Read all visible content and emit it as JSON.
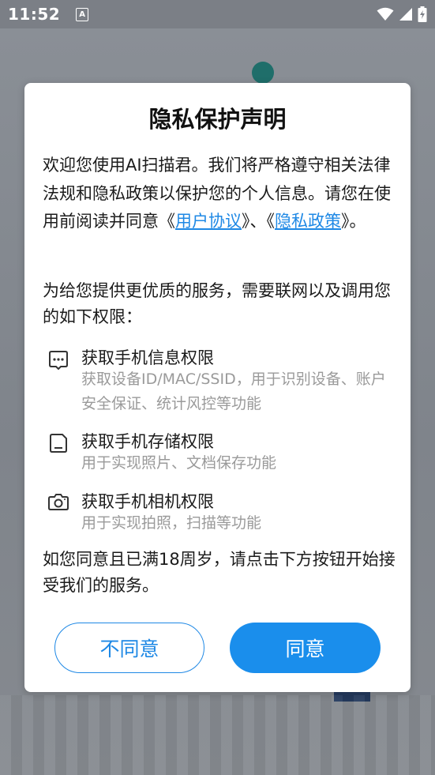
{
  "status_bar": {
    "time": "11:52",
    "notification_icon_letter": "A",
    "icons": [
      "wifi-icon",
      "signal-icon",
      "battery-charging-icon"
    ]
  },
  "dialog": {
    "title": "隐私保护声明",
    "intro": {
      "text_1": "欢迎您使用AI扫描君。我们将严格遵守相关法律法规和隐私政策以保护您的个人信息。请您在使用前阅读并同意《",
      "user_agreement_link": "用户协议",
      "text_2": "》、《",
      "privacy_policy_link": "隐私政策",
      "text_3": "》。"
    },
    "permission_intro": "为给您提供更优质的服务，需要联网以及调用您的如下权限：",
    "permissions": [
      {
        "icon": "phone-info-icon",
        "title": "获取手机信息权限",
        "description": "获取设备ID/MAC/SSID，用于识别设备、账户安全保证、统计风控等功能"
      },
      {
        "icon": "storage-icon",
        "title": "获取手机存储权限",
        "description": "用于实现照片、文档保存功能"
      },
      {
        "icon": "camera-icon",
        "title": "获取手机相机权限",
        "description": "用于实现拍照，扫描等功能"
      }
    ],
    "closing": "如您同意且已满18周岁，请点击下方按钮开始接受我们的服务。",
    "buttons": {
      "decline": "不同意",
      "accept": "同意"
    }
  },
  "colors": {
    "accent": "#1e88e5",
    "accent_fill": "#1a8eec",
    "scrim": "#7b7f86"
  }
}
